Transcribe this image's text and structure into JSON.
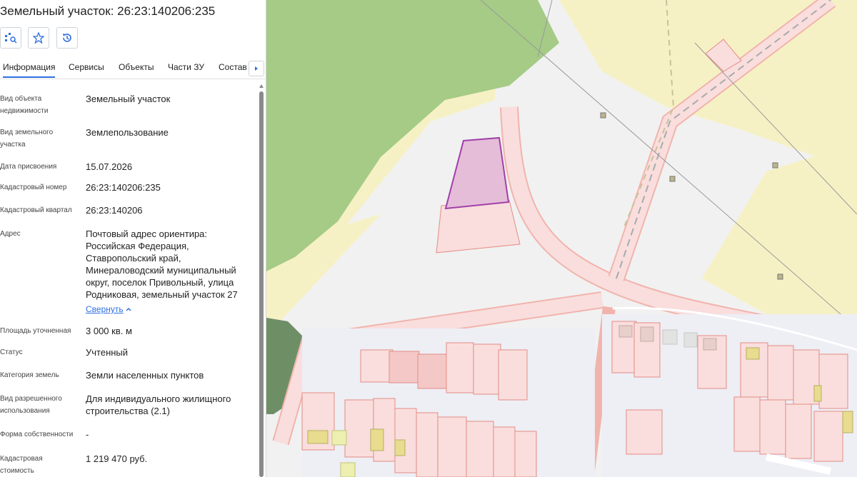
{
  "panel": {
    "title": "Земельный участок: 26:23:140206:235",
    "tools": [
      {
        "icon": "parcel-search-icon"
      },
      {
        "icon": "star-icon"
      },
      {
        "icon": "history-icon"
      }
    ],
    "tabs": [
      "Информация",
      "Сервисы",
      "Объекты",
      "Части ЗУ",
      "Состав"
    ],
    "active_tab": "Информация",
    "fields": [
      {
        "label": "Вид объекта недвижимости",
        "value": "Земельный участок"
      },
      {
        "label": "Вид земельного участка",
        "value": "Землепользование"
      },
      {
        "label": "Дата присвоения",
        "value": "15.07.2026"
      },
      {
        "label": "Кадастровый номер",
        "value": "26:23:140206:235"
      },
      {
        "label": "Кадастровый квартал",
        "value": "26:23:140206"
      },
      {
        "label": "Адрес",
        "value": "Почтовый адрес ориентира: Российская Федерация, Ставропольский край, Минераловодский муниципальный округ, поселок Привольный, улица Родниковая, земельный участок 27"
      },
      {
        "label": "Площадь уточненная",
        "value": "3 000 кв. м"
      },
      {
        "label": "Статус",
        "value": "Учтенный"
      },
      {
        "label": "Категория земель",
        "value": "Земли населенных пунктов"
      },
      {
        "label": "Вид разрешенного использования",
        "value": "Для индивидуального жилищного строительства (2.1)"
      },
      {
        "label": "Форма собственности",
        "value": "-"
      },
      {
        "label": "Кадастровая стоимость",
        "value": "1 219 470 руб."
      }
    ],
    "collapse_link": "Свернуть"
  },
  "colors": {
    "accent": "#2f6fe0",
    "forest": "#a5cb86",
    "zone_yellow": "#f6f1c4",
    "parcel_pink": "#f9dedd",
    "parcel_stroke": "#e48c84",
    "selected_fill": "#e5bdd9",
    "selected_stroke": "#a040a8"
  }
}
